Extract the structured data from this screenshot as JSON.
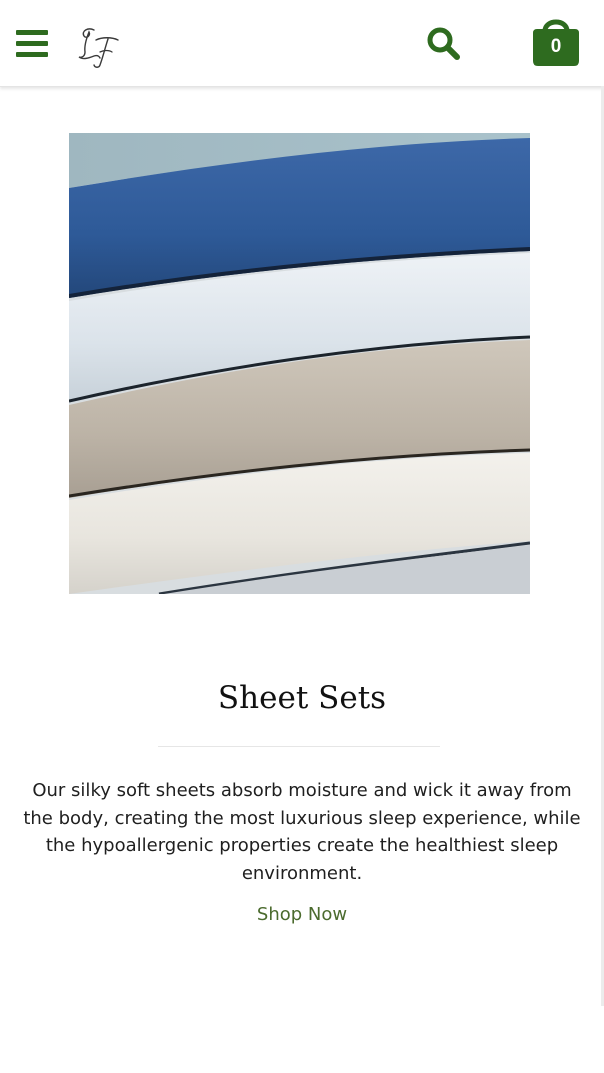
{
  "header": {
    "menu_icon": "hamburger-menu-icon",
    "logo_text": "LF",
    "search_icon": "search-icon",
    "cart_icon": "shopping-bag-icon",
    "cart_count": "0"
  },
  "main": {
    "image_subject": "stacked folded bed sheets",
    "title": "Sheet Sets",
    "description": "Our silky soft sheets absorb moisture and wick it away from the body, creating the most luxurious sleep experience, while the hypoallergenic properties create the healthiest sleep environment.",
    "link_label": "Shop Now"
  },
  "colors": {
    "brand_green": "#2e6b1f",
    "link_green": "#4b6b2e",
    "text": "#1f1f1f"
  }
}
